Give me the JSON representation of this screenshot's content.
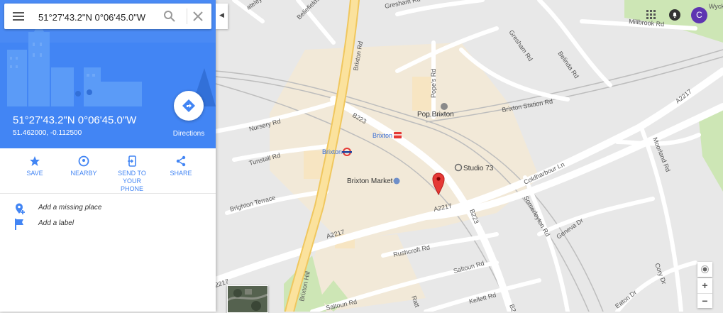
{
  "search": {
    "value": "51°27'43.2\"N 0°06'45.0\"W"
  },
  "place": {
    "title": "51°27'43.2\"N 0°06'45.0\"W",
    "decimal": "51.462000, -0.112500",
    "directions_label": "Directions"
  },
  "actions": [
    {
      "label": "SAVE"
    },
    {
      "label": "NEARBY"
    },
    {
      "label": "SEND TO YOUR",
      "label2": "PHONE"
    },
    {
      "label": "SHARE"
    }
  ],
  "extras": [
    {
      "label": "Add a missing place"
    },
    {
      "label": "Add a label"
    }
  ],
  "account": {
    "initial": "C"
  },
  "zoom": {
    "in": "+",
    "out": "−"
  },
  "map": {
    "labels": {
      "brixton_rd": "Brixton Rd",
      "brixton_hill": "Brixton Hill",
      "popes_rd": "Pope's Rd",
      "pop_brixton": "Pop Brixton",
      "brixton_station_rd": "Brixton Station Rd",
      "a2217_ne": "A2217",
      "nursery_rd": "Nursery Rd",
      "b223_north": "B223",
      "brixton_rail": "Brixton",
      "brixton_tube": "Brixton",
      "studio73": "Studio 73",
      "coldharbour_ln": "Coldharbour Ln",
      "tunstall_rd": "Tunstall Rd",
      "brixton_market": "Brixton Market",
      "moorland_rd": "Moorland Rd",
      "brighton_terrace": "Brighton Terrace",
      "a2217_mid": "A2217",
      "b223_south": "B223",
      "somerleyton_rd": "Somerleyton Rd",
      "geneva_dr": "Geneva Dr",
      "a2217_west": "A2217",
      "rushcroft_rd": "Rushcroft Rd",
      "saltoun_rd_east": "Saltoun Rd",
      "saltoun_rd_west": "Saltoun Rd",
      "kellett_rd": "Kellett Rd",
      "cory_dr": "Cory Dr",
      "eaton_dr": "Eaton Dr",
      "gresham_rd_top": "Gresham Rd",
      "gresham_rd": "Gresham Rd",
      "belinda_rd": "Belinda Rd",
      "millbrook_rd": "Millbrook Rd",
      "wyck": "Wyck",
      "a2217_sw": "2217",
      "b22_bottom": "B2",
      "yateley_rd": "ateley Rd",
      "beliefields_rd": "Beliefields Rd",
      "rattray": "Ratt"
    }
  }
}
